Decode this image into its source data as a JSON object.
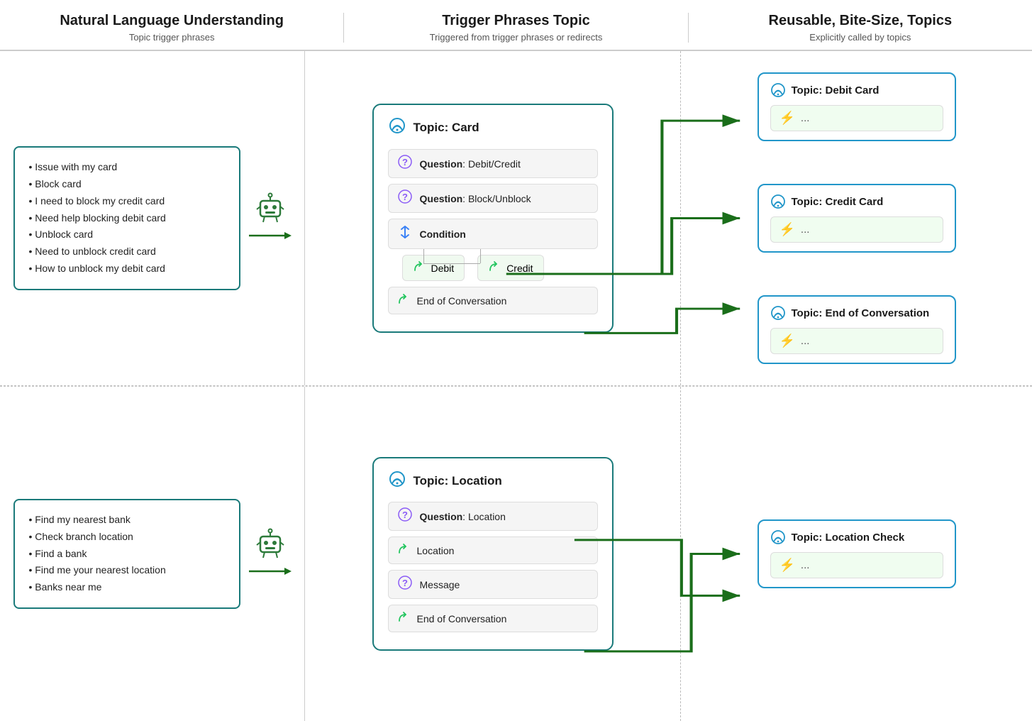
{
  "header": {
    "col1": {
      "title": "Natural Language Understanding",
      "sub": "Topic trigger phrases"
    },
    "col2": {
      "title": "Trigger Phrases Topic",
      "sub": "Triggered from trigger phrases or redirects"
    },
    "col3": {
      "title": "Reusable, Bite-Size, Topics",
      "sub": "Explicitly called by topics"
    }
  },
  "top": {
    "nlu_phrases": [
      "Issue with my card",
      "Block card",
      "I need to block my credit card",
      "Need help blocking debit card",
      "Unblock card",
      "Need to unblock credit card",
      "How to unblock my debit card"
    ],
    "topic_title": "Topic: Card",
    "flow_items": [
      {
        "type": "question",
        "label": "Question",
        "detail": "Debit/Credit"
      },
      {
        "type": "question",
        "label": "Question",
        "detail": "Block/Unblock"
      },
      {
        "type": "condition",
        "label": "Condition"
      }
    ],
    "branches": [
      "Debit",
      "Credit"
    ],
    "end_label": "End of Conversation"
  },
  "bottom": {
    "nlu_phrases": [
      "Find my nearest bank",
      "Check branch location",
      "Find a bank",
      "Find me your nearest location",
      "Banks near me"
    ],
    "topic_title": "Topic: Location",
    "flow_items": [
      {
        "type": "question",
        "label": "Question",
        "detail": "Location"
      },
      {
        "type": "redirect",
        "label": "Location"
      },
      {
        "type": "question",
        "label": "Message"
      },
      {
        "type": "end",
        "label": "End of Conversation"
      }
    ]
  },
  "right_topics": {
    "top": [
      {
        "title": "Topic: Debit Card",
        "dots": "..."
      },
      {
        "title": "Topic: Credit Card",
        "dots": "..."
      },
      {
        "title": "Topic: End of Conversation",
        "dots": "..."
      }
    ],
    "bottom": [
      {
        "title": "Topic: Location Check",
        "dots": "..."
      }
    ]
  },
  "icons": {
    "robot": "🤖",
    "topic": "📡",
    "question": "?",
    "condition": "⇅",
    "redirect": "↪",
    "end": "↪",
    "lightning": "⚡"
  }
}
